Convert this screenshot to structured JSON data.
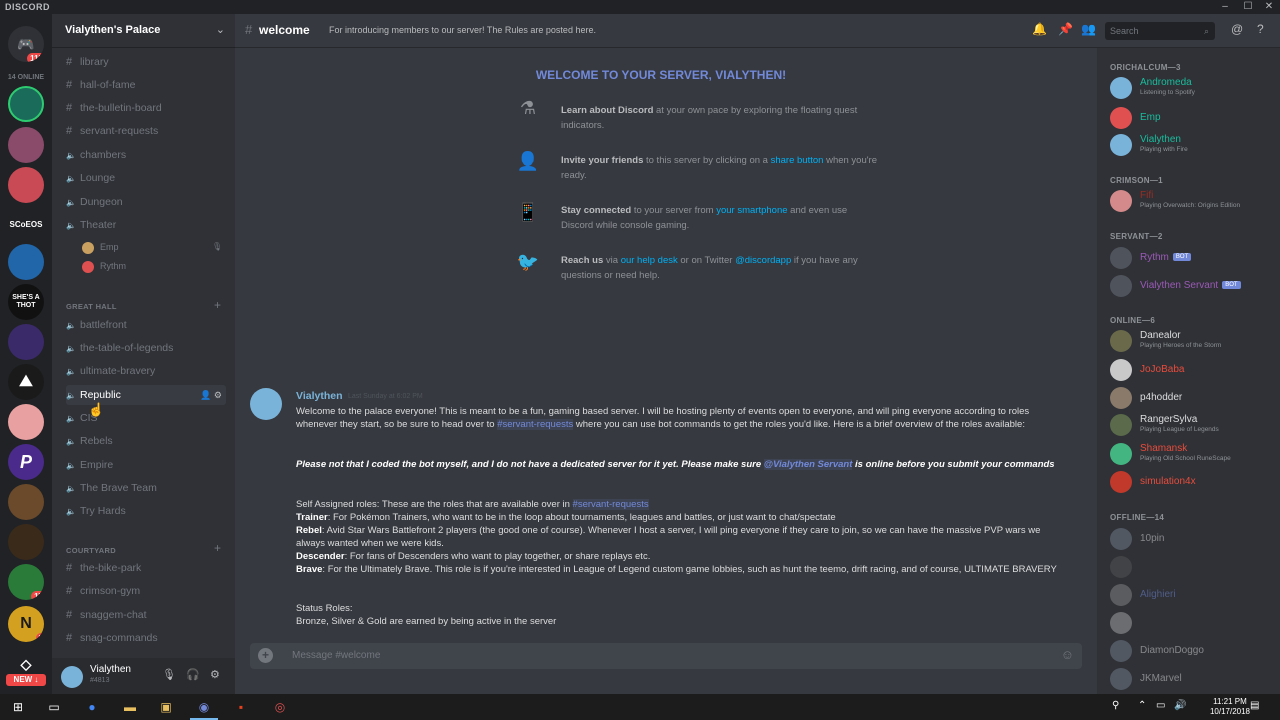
{
  "app": {
    "brand": "DISCORD"
  },
  "window_controls": [
    "–",
    "☐",
    "✕"
  ],
  "server_rail": {
    "online_count": "14 ONLINE",
    "home_badge": "115",
    "scoeos_label": "SCoEOS",
    "shes_label": "SHE'S A THOT",
    "badge_17": "17",
    "badge_5": "5",
    "new_label": "NEW ↓"
  },
  "guild": {
    "name": "Vialythen's Palace"
  },
  "channels": [
    {
      "name": "library",
      "type": "text"
    },
    {
      "name": "hall-of-fame",
      "type": "text"
    },
    {
      "name": "the-bulletin-board",
      "type": "text"
    },
    {
      "name": "servant-requests",
      "type": "text"
    },
    {
      "name": "chambers",
      "type": "voice"
    },
    {
      "name": "Lounge",
      "type": "voice"
    },
    {
      "name": "Dungeon",
      "type": "voice"
    },
    {
      "name": "Theater",
      "type": "voice"
    }
  ],
  "theater_users": [
    "Emp",
    "Rythm"
  ],
  "categories": {
    "great_hall": "GREAT HALL",
    "courtyard": "COURTYARD"
  },
  "great_hall_channels": [
    {
      "name": "battlefront",
      "type": "voice"
    },
    {
      "name": "the-table-of-legends",
      "type": "voice"
    },
    {
      "name": "ultimate-bravery",
      "type": "voice"
    },
    {
      "name": "Republic",
      "type": "voice",
      "active": true
    },
    {
      "name": "CIS",
      "type": "voice"
    },
    {
      "name": "Rebels",
      "type": "voice"
    },
    {
      "name": "Empire",
      "type": "voice"
    },
    {
      "name": "The Brave Team",
      "type": "voice"
    },
    {
      "name": "Try Hards",
      "type": "voice"
    }
  ],
  "courtyard_channels": [
    {
      "name": "the-bike-park",
      "type": "text"
    },
    {
      "name": "crimson-gym",
      "type": "text"
    },
    {
      "name": "snaggem-chat",
      "type": "text"
    },
    {
      "name": "snag-commands",
      "type": "text"
    }
  ],
  "user_panel": {
    "username": "Vialythen",
    "tag": "#4813"
  },
  "topbar": {
    "channel": "welcome",
    "topic": "For introducing members to our server! The Rules are posted here.",
    "search_placeholder": "Search"
  },
  "welcome": {
    "title": "WELCOME TO YOUR SERVER, VIALYTHEN!",
    "tips": [
      {
        "bold": "Learn about Discord",
        "text": " at your own pace by exploring the floating quest indicators."
      },
      {
        "bold": "Invite your friends",
        "text": " to this server by clicking on a ",
        "link": "share button",
        "text2": " when you're ready."
      },
      {
        "bold": "Stay connected",
        "text": " to your server from ",
        "link": "your smartphone",
        "text2": " and even use Discord while console gaming."
      },
      {
        "bold": "Reach us",
        "text": " via ",
        "link": "our help desk",
        "text2": " or on Twitter ",
        "link2": "@discordapp",
        "text3": " if you have any questions or need help."
      }
    ]
  },
  "message": {
    "author": "Vialythen",
    "timestamp": "Last Sunday at 6:02 PM",
    "p1a": "Welcome to the palace everyone! This is meant to be a fun, gaming based server. I will be hosting plenty of events open to everyone, and will ping everyone according to roles whenever they start, so be sure to head over to ",
    "p1_link": "#servant-requests",
    "p1b": " where you can use bot commands to get the roles you'd like. Here is a brief overview of the roles available:",
    "p2a": "Please not that I coded the bot myself, and I do not have a dedicated server for it yet. Please make sure ",
    "p2_mention": "@Vialythen Servant",
    "p2b": " is online before you submit your commands",
    "p3a": "Self Assigned roles: These are the roles that are available over in ",
    "p3_link": "#servant-requests",
    "roles": [
      {
        "name": "Trainer",
        "desc": ": For Pokémon Trainers, who want to be in the loop about tournaments, leagues and battles, or just want to chat/spectate"
      },
      {
        "name": "Rebel",
        "desc": ": Avid Star Wars Battlefront 2 players (the good one of course). Whenever I host a server, I will ping everyone if they care to join, so we can have the massive PVP wars we always wanted when we were kids."
      },
      {
        "name": "Descender",
        "desc": ": For fans of Descenders who want to play together, or share replays etc."
      },
      {
        "name": "Brave",
        "desc": ": For the Ultimately Brave. This role is if you're interested in League of Legend custom game lobbies, such as hunt the teemo, drift racing, and of course, ULTIMATE BRAVERY"
      }
    ],
    "status_title": "Status Roles:",
    "status_desc": "Bronze, Silver & Gold are earned by being active in the server"
  },
  "composer": {
    "placeholder": "Message #welcome"
  },
  "members": {
    "categories": [
      "ORICHALCUM—3",
      "CRIMSON—1",
      "SERVANT—2",
      "ONLINE—6",
      "OFFLINE—14"
    ],
    "orichalcum": [
      {
        "name": "Andromeda",
        "activity": "Listening to Spotify",
        "color": "#1abc9c"
      },
      {
        "name": "Emp",
        "activity": "",
        "color": "#1abc9c"
      },
      {
        "name": "Vialythen",
        "activity": "Playing with Fire",
        "color": "#1abc9c"
      }
    ],
    "crimson": [
      {
        "name": "Fifi",
        "activity": "Playing Overwatch: Origins Edition",
        "color": "#992d22"
      }
    ],
    "servant": [
      {
        "name": "Rythm",
        "bot": "BOT",
        "color": "#9b59b6"
      },
      {
        "name": "Vialythen Servant",
        "bot": "BOT",
        "color": "#9b59b6"
      }
    ],
    "online": [
      {
        "name": "Danealor",
        "activity": "Playing Heroes of the Storm",
        "color": "#dcddde"
      },
      {
        "name": "JoJoBaba",
        "activity": "",
        "color": "#e74c3c"
      },
      {
        "name": "p4hodder",
        "activity": "",
        "color": "#dcddde"
      },
      {
        "name": "RangerSylva",
        "activity": "Playing League of Legends",
        "color": "#dcddde"
      },
      {
        "name": "Shamansk",
        "activity": "Playing Old School RuneScape",
        "color": "#e74c3c"
      },
      {
        "name": "simulation4x",
        "activity": "",
        "color": "#e74c3c"
      }
    ],
    "offline": [
      {
        "name": "10pin",
        "color": "#8e9297"
      },
      {
        "name": "",
        "color": "#8e9297"
      },
      {
        "name": "Alighieri",
        "color": "#5e6ba0"
      },
      {
        "name": "",
        "color": "#8e9297"
      },
      {
        "name": "DiamonDoggo",
        "color": "#8e9297"
      },
      {
        "name": "JKMarvel",
        "color": "#8e9297"
      }
    ]
  },
  "taskbar": {
    "time": "11:21 PM",
    "date": "10/17/2018"
  }
}
